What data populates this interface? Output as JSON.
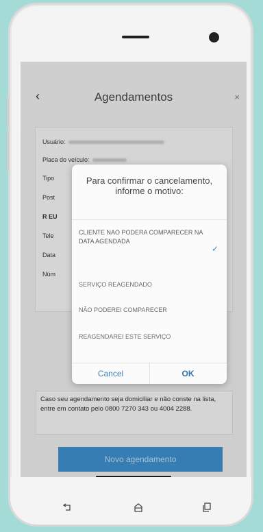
{
  "header": {
    "title": "Agendamentos",
    "back_glyph": "‹",
    "close_glyph": "×"
  },
  "info_card": {
    "rows": [
      {
        "label": "Usuário:"
      },
      {
        "label": "Placa do veículo:"
      },
      {
        "label": "Tipo"
      },
      {
        "label": "Post"
      },
      {
        "label": "R EU"
      },
      {
        "label": "Tele"
      },
      {
        "label": "Data"
      },
      {
        "label": "Núm"
      }
    ]
  },
  "dialog": {
    "title": "Para confirmar o cancelamento, informe o motivo:",
    "options": [
      {
        "label": "CLIENTE NAO PODERA COMPARECER NA DATA AGENDADA",
        "selected": true
      },
      {
        "label": "SERVIÇO REAGENDADO",
        "selected": false
      },
      {
        "label": "NÃO PODEREI COMPARECER",
        "selected": false
      },
      {
        "label": "REAGENDAREI ESTE SERVIÇO",
        "selected": false
      }
    ],
    "cancel_label": "Cancel",
    "ok_label": "OK"
  },
  "notice": {
    "text": "Caso seu agendamento seja domiciliar e não conste na lista, entre em contato pelo 0800 7270 343 ou 4004 2288."
  },
  "actions": {
    "new_appointment_label": "Novo agendamento"
  },
  "icons": {
    "back": "chevron-left-icon",
    "close": "close-icon",
    "check": "checkmark-icon",
    "trash": "trash-icon",
    "nav_back": "nav-back-icon",
    "nav_home": "nav-home-icon",
    "nav_recent": "nav-recent-icon"
  },
  "colors": {
    "background": "#a5dbd6",
    "accent": "#3b8cc8",
    "dialog_button": "#3b7fb8"
  }
}
